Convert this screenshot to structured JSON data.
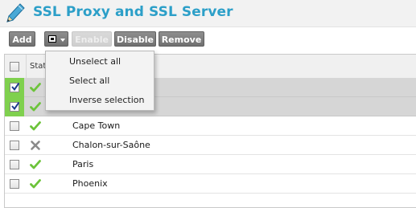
{
  "header": {
    "title": "SSL Proxy and SSL Server",
    "icon": "pen-icon",
    "title_color": "#2c9fc8"
  },
  "toolbar": {
    "add_label": "Add",
    "enable_label": "Enable",
    "disable_label": "Disable",
    "remove_label": "Remove",
    "enable_disabled": true
  },
  "select_menu": {
    "items": [
      {
        "label": "Unselect all"
      },
      {
        "label": "Select all"
      },
      {
        "label": "Inverse selection"
      }
    ]
  },
  "grid": {
    "columns": [
      "Status"
    ],
    "rows": [
      {
        "name": "",
        "status": "enabled",
        "selected": true
      },
      {
        "name": "",
        "status": "enabled",
        "selected": true
      },
      {
        "name": "Cape Town",
        "status": "enabled",
        "selected": false
      },
      {
        "name": "Chalon-sur-Saône",
        "status": "disabled",
        "selected": false
      },
      {
        "name": "Paris",
        "status": "enabled",
        "selected": false
      },
      {
        "name": "Phoenix",
        "status": "enabled",
        "selected": false
      }
    ],
    "colors": {
      "enabled": "#6cc33a",
      "disabled": "#8a8a8a",
      "selected_row": "#d6d6d6",
      "selected_stripe": "#7fd04e"
    }
  }
}
